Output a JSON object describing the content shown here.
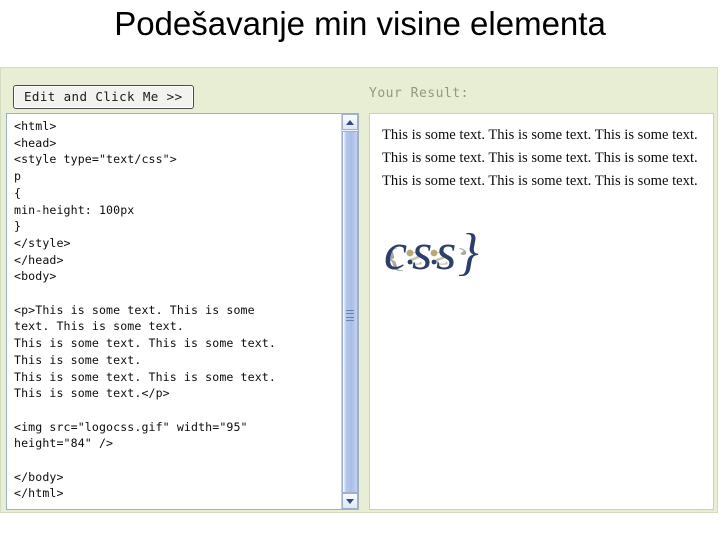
{
  "slide": {
    "title": "Podešavanje min visine elementa"
  },
  "editor": {
    "edit_button_label": "Edit and Click Me >>",
    "result_caption": "Your Result:",
    "code": "<html>\n<head>\n<style type=\"text/css\">\np\n{\nmin-height: 100px\n}\n</style>\n</head>\n<body>\n\n<p>This is some text. This is some\ntext. This is some text.\nThis is some text. This is some text.\nThis is some text.\nThis is some text. This is some text.\nThis is some text.</p>\n\n<img src=\"logocss.gif\" width=\"95\"\nheight=\"84\" />\n\n</body>\n</html>"
  },
  "result": {
    "paragraph": "This is some text. This is some text. This is some text. This is some text. This is some text. This is some text. This is some text. This is some text. This is some text.",
    "image_alt": "logocss.gif"
  },
  "scrollbar": {
    "up_arrow": "scroll-up-arrow",
    "down_arrow": "scroll-down-arrow"
  },
  "colors": {
    "panel_background": "#e7eed3",
    "panel_border": "#d4dcc0",
    "caption_text": "#8f9b79",
    "scrollbar_thumb": "#a9bde8",
    "logo_navy": "#2c3f6b",
    "logo_shadow": "#b9b29a"
  }
}
